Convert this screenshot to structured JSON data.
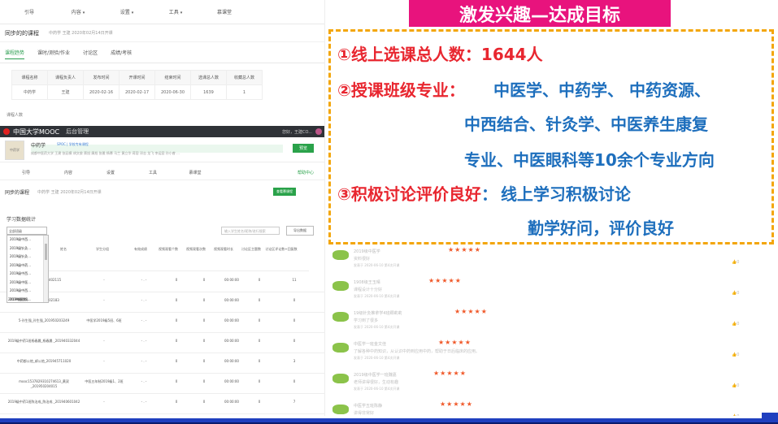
{
  "left_screenshot": {
    "topnav": [
      "引导",
      "内容",
      "设置",
      "工具",
      "慕课堂"
    ],
    "course_title": "同步的的课程",
    "course_meta": "中药学  王建  2020年02月14日开课",
    "tabs": [
      "课程趋势",
      "课时/测验/作业",
      "讨论区",
      "成绩/考核"
    ],
    "stat_table": {
      "headers": [
        "课程名称",
        "课程负责人",
        "发布时间",
        "开课时间",
        "结束时间",
        "选课总人数",
        "收藏总人数"
      ],
      "row": [
        "中药学",
        "王建",
        "2020-02-16",
        "2020-02-17",
        "2020-06-30",
        "1639",
        "1"
      ]
    },
    "section_label": "课程人数",
    "mooc_bar": {
      "brand": "中国大学MOOC",
      "admin": "后台管理",
      "user": "您好，王建CO..."
    },
    "course_card": {
      "thumb": "中药学",
      "name": "中药学",
      "tag": "SPOC | 学校专有课程",
      "teachers": "成都中医药大学  王建  张廷模  胡文俊  蔡旭  康旭  张雅  杨慕  马兰  黄立华  蒋容  邓志  龙飞  李运容  孙小睿 ...",
      "button": "预览"
    },
    "subnav": [
      "引导",
      "内容",
      "设置",
      "工具",
      "慕课堂"
    ],
    "help": "帮助中心",
    "course_title2": "同步的课程",
    "course_meta2": "中药学  王建  2020年02月14日开课",
    "course_btn": "查看慕课程",
    "learn_title": "学习数据统计",
    "class_select": "全部班级",
    "dropdown": [
      "2019级中西...",
      "2019级针灸...",
      "2019级针灸...",
      "2019级中药...",
      "2019级中西...",
      "2019级中医...",
      "2019级中西...",
      "2019级眼镜...",
      "2019中医学..."
    ],
    "search_placeholder": "输入学生姓名/昵称/进行搜索",
    "export": "导出数据",
    "grid_headers": [
      "姓名",
      "学生分组",
      "有效成绩",
      "视频观看个数",
      "视频观看次数",
      "视频观看时长",
      "讨论区主题数",
      "讨论区评论数+回复数"
    ],
    "grid_rows": [
      {
        "name": "...迅捷录_魏涛 402115",
        "group": "-",
        "score": "- . -",
        "v1": "0",
        "v2": "0",
        "v3": "00:00:00",
        "d1": "0",
        "d2": "11"
      },
      {
        "name": "...._201950402183",
        "group": "-",
        "score": "- . -",
        "v1": "0",
        "v2": "0",
        "v3": "00:00:00",
        "d1": "0",
        "d2": "0"
      },
      {
        "name": "5-孙生强_孙生强_201950203249",
        "group": "中医学2019级5班、6班",
        "score": "- . -",
        "v1": "0",
        "v2": "0",
        "v3": "00:00:00",
        "d1": "0",
        "d2": "0"
      },
      {
        "name": "2019级中药1班杨春晨_杨春晨 _201940332044",
        "group": "-",
        "score": "- . -",
        "v1": "0",
        "v2": "0",
        "v3": "00:00:00",
        "d1": "0",
        "d2": "0"
      },
      {
        "name": "中药都公他_郝公他_201945711020",
        "group": "-",
        "score": "- . -",
        "v1": "0",
        "v2": "0",
        "v3": "00:00:00",
        "d1": "0",
        "d2": "3"
      },
      {
        "name": "mooc1537829310274613_黄双 _201950204015",
        "group": "中医五年制2019级1、2班",
        "score": "- . -",
        "v1": "0",
        "v2": "0",
        "v3": "00:00:00",
        "d1": "0",
        "d2": "0"
      },
      {
        "name": "2019级中药1班陈治成_陈治成 _201940601042",
        "group": "-",
        "score": "- . -",
        "v1": "0",
        "v2": "0",
        "v3": "00:00:00",
        "d1": "0",
        "d2": "7"
      }
    ]
  },
  "banner": "激发兴趣—达成目标",
  "bullets": {
    "b1_label": "①线上选课总人数：1644人",
    "b2_label": "②授课班级专业：",
    "b2_line1": "中医学、中药学、 中药资源、",
    "b2_line2": "中西结合、针灸学、中医养生康复",
    "b2_line3": "专业、中医眼科等10余个专业方向",
    "b3_label": "③积极讨论评价良好",
    "b3_colon": "：",
    "b3_line1": "线上学习积极讨论",
    "b3_line2": "勤学好问，评价良好"
  },
  "comments": [
    {
      "who": "2019级中医学",
      "stars": "★★★★★",
      "text": "资料很好",
      "date": "发表于 2020-06-10  第4次开课",
      "likes": "0"
    },
    {
      "who": "1908级王玉晴",
      "stars": "★★★★★",
      "text": "课程设计十分好",
      "date": "发表于 2020-06-10  第4次开课",
      "likes": "0"
    },
    {
      "who": "19级针灸推拿学4班卿莉莉",
      "stars": "★★★★★",
      "text": "学习到了很多",
      "date": "发表于 2020-06-10  第4次开课",
      "likes": "0"
    },
    {
      "who": "中医学一班金文佳",
      "stars": "★★★★★",
      "text": "了解各种中药知识，从认识中药到应用中药，帮助于日后临床的应用。",
      "date": "发表于 2020-06-10  第4次开课",
      "likes": "0"
    },
    {
      "who": "2019级中医学一班魏嘉",
      "stars": "★★★★★",
      "text": "老师讲得很好，生动有趣",
      "date": "发表于 2020-06-10  第4次开课",
      "likes": "0"
    },
    {
      "who": "中医学五班陈静",
      "stars": "★★★★★",
      "text": "讲得非常好",
      "date": "",
      "likes": "0"
    }
  ]
}
